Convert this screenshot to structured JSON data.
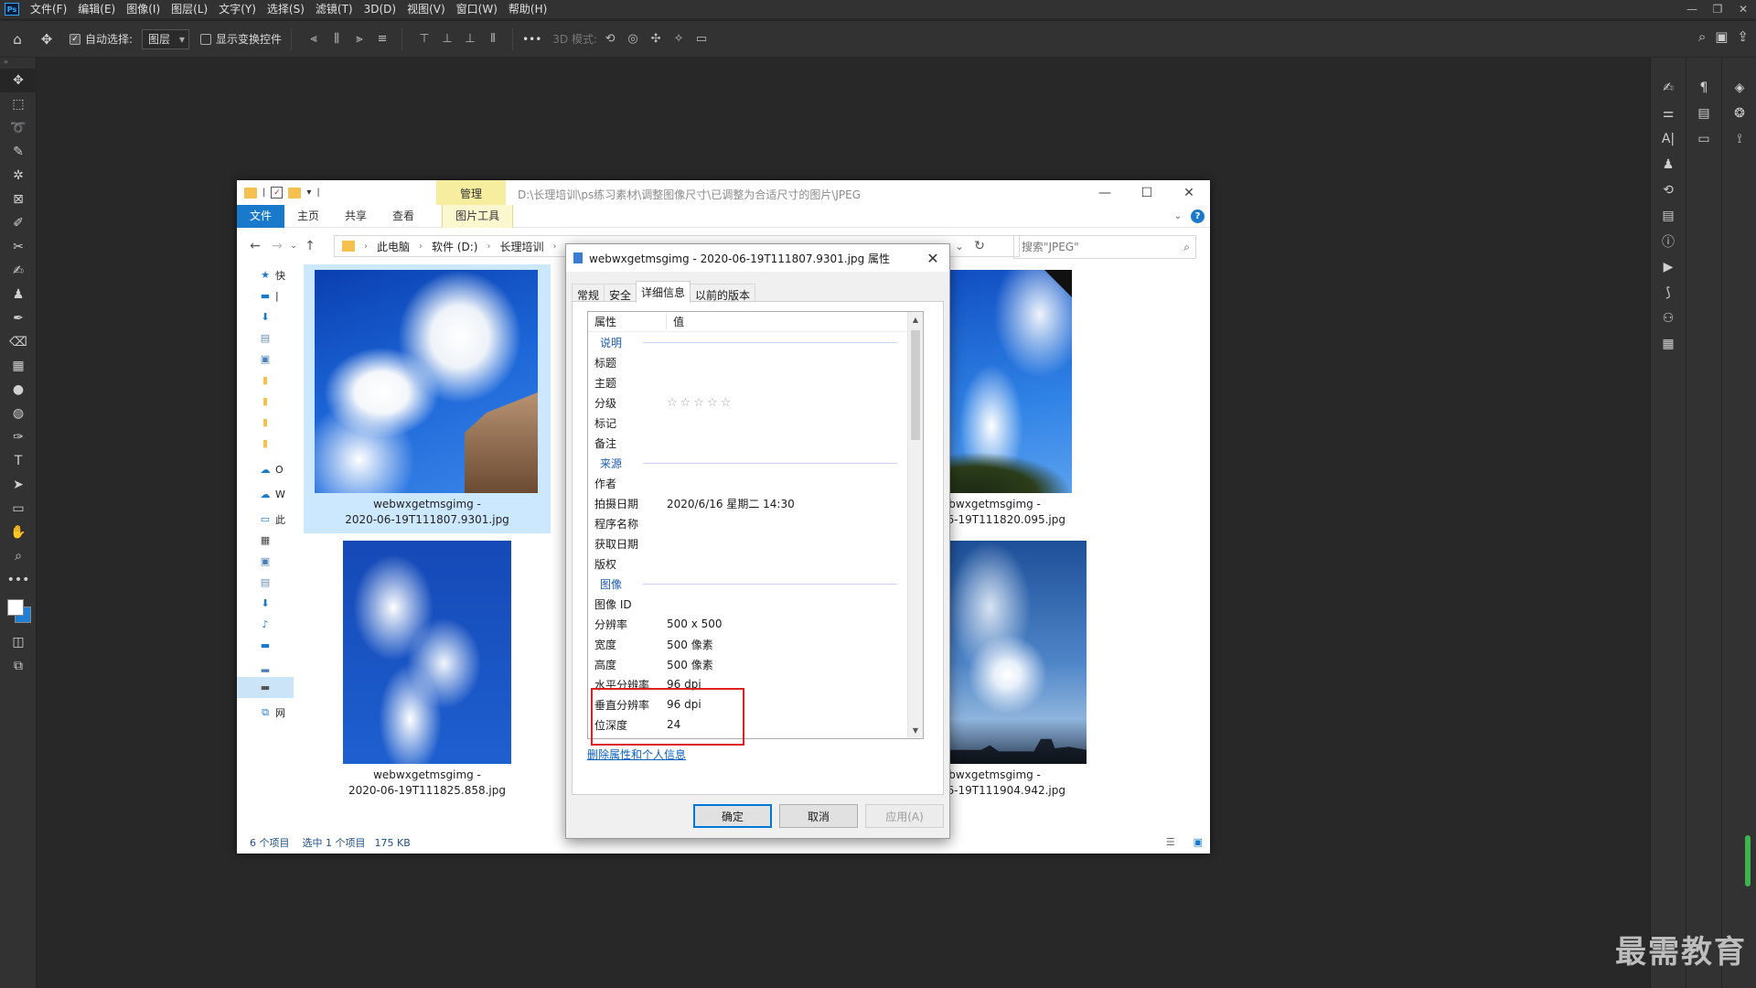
{
  "ps": {
    "menu": [
      "文件(F)",
      "编辑(E)",
      "图像(I)",
      "图层(L)",
      "文字(Y)",
      "选择(S)",
      "滤镜(T)",
      "3D(D)",
      "视图(V)",
      "窗口(W)",
      "帮助(H)"
    ],
    "logo": "Ps",
    "options": {
      "auto_select_label": "自动选择:",
      "layer_select_value": "图层",
      "show_transform_label": "显示变换控件",
      "more": "•••",
      "mode_3d_label": "3D 模式:"
    },
    "window_controls": [
      "—",
      "❐",
      "✕"
    ]
  },
  "watermark": "最需教育",
  "explorer": {
    "title_path": "D:\\长理培训\\ps练习素材\\调整图像尺寸\\已调整为合适尺寸的图片\\JPEG",
    "manage_tab": "管理",
    "tabs": {
      "file": "文件",
      "home": "主页",
      "share": "共享",
      "view": "查看",
      "picture_tools": "图片工具"
    },
    "breadcrumb": [
      "此电脑",
      "软件 (D:)",
      "长理培训"
    ],
    "search_placeholder": "搜索\"JPEG\"",
    "nav_items": [
      "快",
      "",
      "",
      "",
      "",
      "",
      "",
      "",
      "",
      "O",
      "W",
      "此",
      "",
      "",
      "",
      "",
      "",
      "",
      "",
      "",
      "",
      "网"
    ],
    "files": [
      {
        "name_line1": "webwxgetmsgimg -",
        "name_line2": "2020-06-19T111807.9301.jpg"
      },
      {
        "name_line1": "webwxgetmsgimg -",
        "name_line2": "2020-06-19T111820.095.jpg"
      },
      {
        "name_line1": "webwxgetmsgimg -",
        "name_line2": "2020-06-19T111825.858.jpg"
      },
      {
        "name_line1": "webwxgetmsgimg -",
        "name_line2": "2020-06-19T111904.942.jpg"
      }
    ],
    "status": {
      "count": "6 个项目",
      "selected": "选中 1 个项目",
      "size": "175 KB"
    }
  },
  "dialog": {
    "title": "webwxgetmsgimg - 2020-06-19T111807.9301.jpg 属性",
    "tabs": [
      "常规",
      "安全",
      "详细信息",
      "以前的版本"
    ],
    "active_tab": "详细信息",
    "columns": {
      "property": "属性",
      "value": "值"
    },
    "groups": {
      "description": {
        "label": "说明",
        "rows": [
          {
            "k": "标题",
            "v": ""
          },
          {
            "k": "主题",
            "v": ""
          },
          {
            "k": "分级",
            "v": "☆☆☆☆☆"
          },
          {
            "k": "标记",
            "v": ""
          },
          {
            "k": "备注",
            "v": ""
          }
        ]
      },
      "origin": {
        "label": "来源",
        "rows": [
          {
            "k": "作者",
            "v": ""
          },
          {
            "k": "拍摄日期",
            "v": "2020/6/16 星期二 14:30"
          },
          {
            "k": "程序名称",
            "v": ""
          },
          {
            "k": "获取日期",
            "v": ""
          },
          {
            "k": "版权",
            "v": ""
          }
        ]
      },
      "image": {
        "label": "图像",
        "rows": [
          {
            "k": "图像 ID",
            "v": ""
          },
          {
            "k": "分辨率",
            "v": "500 x 500"
          },
          {
            "k": "宽度",
            "v": "500 像素"
          },
          {
            "k": "高度",
            "v": "500 像素"
          },
          {
            "k": "水平分辨率",
            "v": "96 dpi"
          },
          {
            "k": "垂直分辨率",
            "v": "96 dpi"
          },
          {
            "k": "位深度",
            "v": "24"
          }
        ]
      }
    },
    "remove_link": "删除属性和个人信息",
    "buttons": {
      "ok": "确定",
      "cancel": "取消",
      "apply": "应用(A)"
    },
    "highlight_color": "#e02020"
  }
}
